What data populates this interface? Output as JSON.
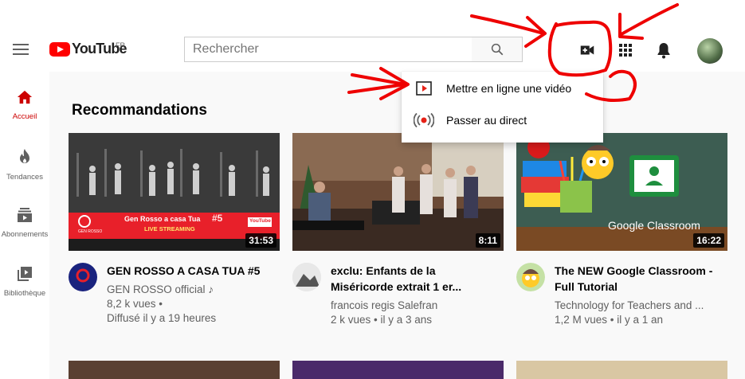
{
  "header": {
    "logo_text": "YouTube",
    "country": "FR",
    "search_placeholder": "Rechercher"
  },
  "header_icons": [
    "menu-icon",
    "search-icon",
    "create-video-icon",
    "apps-grid-icon",
    "notifications-bell-icon",
    "account-avatar"
  ],
  "sidebar": {
    "items": [
      {
        "label": "Accueil",
        "icon": "home-icon",
        "active": true
      },
      {
        "label": "Tendances",
        "icon": "fire-icon"
      },
      {
        "label": "Abonnements",
        "icon": "subscriptions-icon"
      },
      {
        "label": "Bibliothèque",
        "icon": "library-icon"
      }
    ]
  },
  "main": {
    "section_title": "Recommandations",
    "videos": [
      {
        "title": "GEN ROSSO A CASA TUA #5",
        "channel": "GEN ROSSO official",
        "channel_music_note": "♪",
        "views": "8,2 k vues •",
        "date": "Diffusé il y a 19 heures",
        "duration": "31:53",
        "thumb": {
          "banner_title": "Gen Rosso a casa Tua",
          "banner_number": "#5",
          "banner_sub": "LIVE STREAMING",
          "banner_logo": "GEN ROSSO",
          "banner_yt": "YouTube"
        }
      },
      {
        "title": "exclu: Enfants de la Miséricorde extrait 1 er...",
        "channel": "francois regis Salefran",
        "views": "2 k vues",
        "date": "il y a 3 ans",
        "duration": "8:11"
      },
      {
        "title": "The NEW Google Classroom - Full Tutorial",
        "channel": "Technology for Teachers and ...",
        "views": "1,2 M vues",
        "date": "il y a 1 an",
        "duration": "16:22",
        "thumb": {
          "brand": "Google Classroom"
        }
      }
    ]
  },
  "create_menu": {
    "items": [
      {
        "label": "Mettre en ligne une vidéo",
        "icon": "upload-video-icon"
      },
      {
        "label": "Passer au direct",
        "icon": "go-live-icon"
      }
    ]
  },
  "colors": {
    "brand_red": "#ff0000",
    "annotation_red": "#ee0000",
    "active_red": "#cc0000"
  }
}
